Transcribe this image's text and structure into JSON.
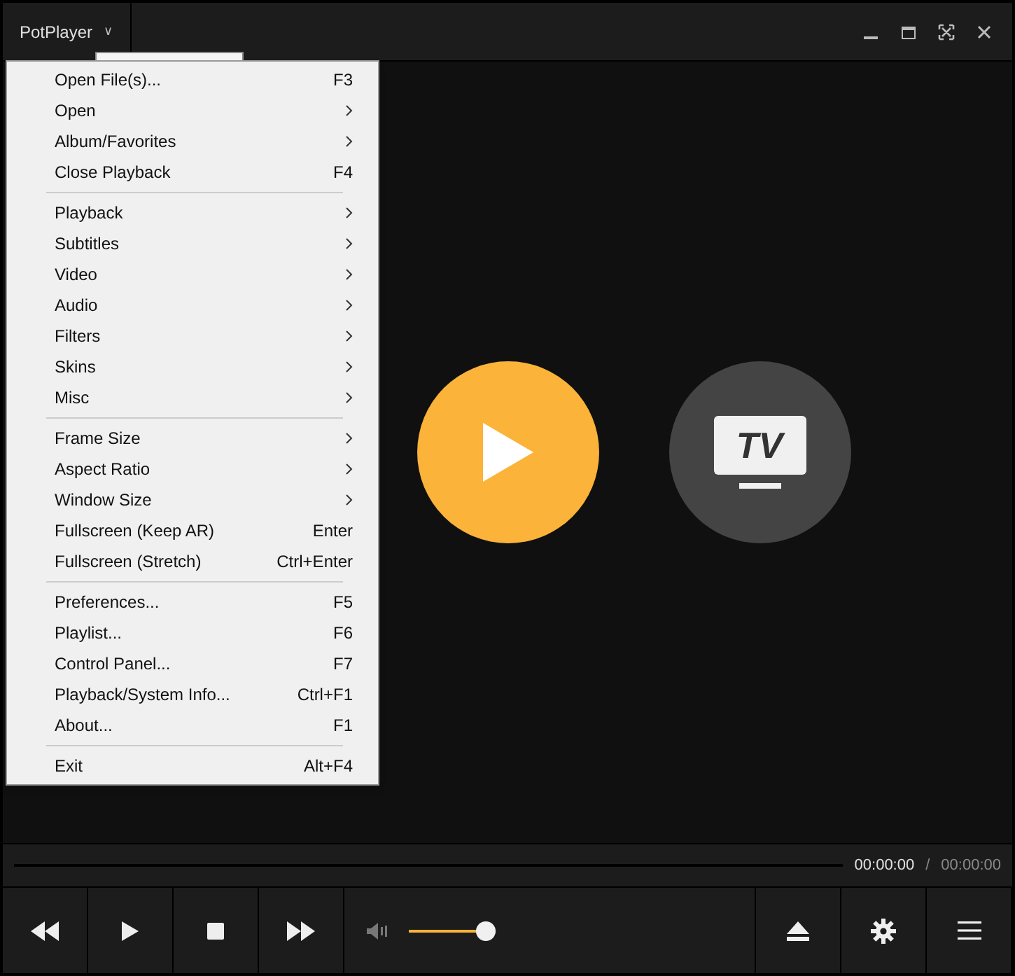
{
  "window": {
    "title": "PotPlayer",
    "title_caret": "∨"
  },
  "menu": {
    "groups": [
      [
        {
          "label": "Open File(s)...",
          "shortcut": "F3",
          "submenu": false
        },
        {
          "label": "Open",
          "submenu": true
        },
        {
          "label": "Album/Favorites",
          "submenu": true
        },
        {
          "label": "Close Playback",
          "shortcut": "F4",
          "submenu": false
        }
      ],
      [
        {
          "label": "Playback",
          "submenu": true
        },
        {
          "label": "Subtitles",
          "submenu": true
        },
        {
          "label": "Video",
          "submenu": true
        },
        {
          "label": "Audio",
          "submenu": true
        },
        {
          "label": "Filters",
          "submenu": true
        },
        {
          "label": "Skins",
          "submenu": true
        },
        {
          "label": "Misc",
          "submenu": true
        }
      ],
      [
        {
          "label": "Frame Size",
          "submenu": true
        },
        {
          "label": "Aspect Ratio",
          "submenu": true
        },
        {
          "label": "Window Size",
          "submenu": true
        },
        {
          "label": "Fullscreen (Keep AR)",
          "shortcut": "Enter",
          "submenu": false
        },
        {
          "label": "Fullscreen (Stretch)",
          "shortcut": "Ctrl+Enter",
          "submenu": false
        }
      ],
      [
        {
          "label": "Preferences...",
          "shortcut": "F5",
          "submenu": false
        },
        {
          "label": "Playlist...",
          "shortcut": "F6",
          "submenu": false
        },
        {
          "label": "Control Panel...",
          "shortcut": "F7",
          "submenu": false
        },
        {
          "label": "Playback/System Info...",
          "shortcut": "Ctrl+F1",
          "submenu": false
        },
        {
          "label": "About...",
          "shortcut": "F1",
          "submenu": false
        }
      ],
      [
        {
          "label": "Exit",
          "shortcut": "Alt+F4",
          "submenu": false
        }
      ]
    ]
  },
  "tv_button": {
    "label": "TV"
  },
  "time": {
    "current": "00:00:00",
    "separator": "/",
    "total": "00:00:00"
  },
  "volume": {
    "level": 1
  }
}
